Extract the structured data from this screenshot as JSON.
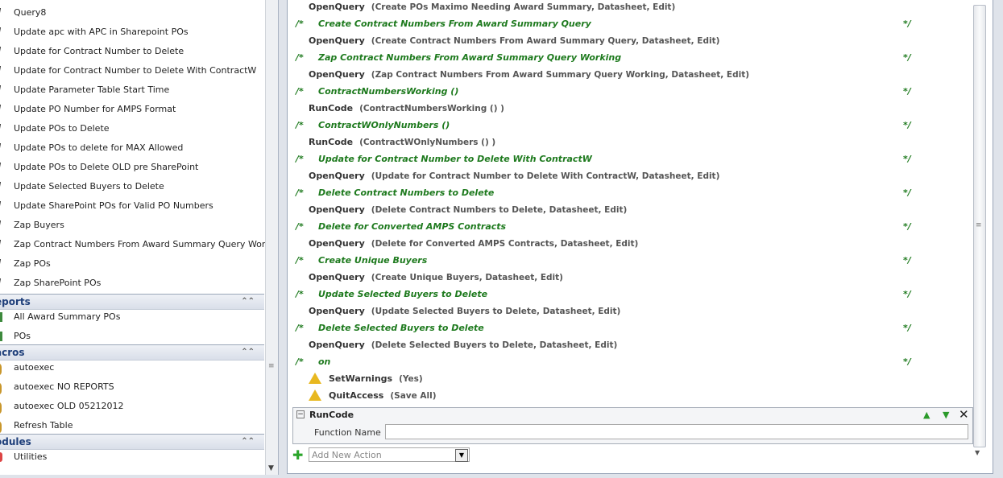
{
  "nav": {
    "queries": [
      "Query8",
      "Update apc with APC in Sharepoint POs",
      "Update for Contract Number to Delete",
      "Update for Contract Number to Delete With ContractW",
      "Update Parameter Table Start Time",
      "Update PO Number for AMPS Format",
      "Update POs to Delete",
      "Update POs to delete for MAX Allowed",
      "Update POs to Delete OLD pre SharePoint",
      "Update Selected Buyers to Delete",
      "Update SharePoint POs for Valid PO Numbers",
      "Zap Buyers",
      "Zap Contract Numbers From Award Summary Query Worki...",
      "Zap POs",
      "Zap SharePoint POs"
    ],
    "groups": [
      {
        "title": "eports",
        "items": [
          "All Award Summary POs",
          "POs"
        ]
      },
      {
        "title": "acros",
        "items": [
          "autoexec",
          "autoexec NO REPORTS",
          "autoexec OLD 05212012",
          "Refresh Table"
        ]
      },
      {
        "title": "odules",
        "items": [
          "Utilities"
        ]
      }
    ],
    "collapse_icon": "⌃⌃"
  },
  "macro": {
    "comment_open": "/*",
    "comment_close": "*/",
    "rows": [
      {
        "type": "action",
        "name": "OpenQuery",
        "args": "(Create POs Maximo Needing Award Summary, Datasheet, Edit)"
      },
      {
        "type": "comment",
        "text": "Create Contract Numbers From Award Summary Query"
      },
      {
        "type": "action",
        "name": "OpenQuery",
        "args": "(Create Contract Numbers From Award Summary Query, Datasheet, Edit)"
      },
      {
        "type": "comment",
        "text": "Zap Contract Numbers From Award Summary Query Working"
      },
      {
        "type": "action",
        "name": "OpenQuery",
        "args": "(Zap Contract Numbers From Award Summary Query Working, Datasheet, Edit)"
      },
      {
        "type": "comment",
        "text": "ContractNumbersWorking ()"
      },
      {
        "type": "action",
        "name": "RunCode",
        "args": "(ContractNumbersWorking () )"
      },
      {
        "type": "comment",
        "text": "ContractWOnlyNumbers ()"
      },
      {
        "type": "action",
        "name": "RunCode",
        "args": "(ContractWOnlyNumbers () )"
      },
      {
        "type": "comment",
        "text": "Update for Contract Number to Delete With ContractW"
      },
      {
        "type": "action",
        "name": "OpenQuery",
        "args": "(Update for Contract Number to Delete With ContractW, Datasheet, Edit)"
      },
      {
        "type": "comment",
        "text": "Delete Contract Numbers to Delete"
      },
      {
        "type": "action",
        "name": "OpenQuery",
        "args": "(Delete Contract Numbers to Delete, Datasheet, Edit)"
      },
      {
        "type": "comment",
        "text": "Delete for Converted AMPS Contracts"
      },
      {
        "type": "action",
        "name": "OpenQuery",
        "args": "(Delete for Converted AMPS Contracts, Datasheet, Edit)"
      },
      {
        "type": "comment",
        "text": "Create Unique Buyers"
      },
      {
        "type": "action",
        "name": "OpenQuery",
        "args": "(Create Unique Buyers, Datasheet, Edit)"
      },
      {
        "type": "comment",
        "text": "Update Selected Buyers to Delete"
      },
      {
        "type": "action",
        "name": "OpenQuery",
        "args": "(Update Selected Buyers to Delete, Datasheet, Edit)"
      },
      {
        "type": "comment",
        "text": "Delete Selected Buyers to Delete"
      },
      {
        "type": "action",
        "name": "OpenQuery",
        "args": "(Delete Selected Buyers to Delete, Datasheet, Edit)"
      },
      {
        "type": "comment",
        "text": "on"
      },
      {
        "type": "warn",
        "name": "SetWarnings",
        "args": "(Yes)"
      },
      {
        "type": "warn",
        "name": "QuitAccess",
        "args": "(Save All)"
      }
    ],
    "edit": {
      "title": "RunCode",
      "field_label": "Function Name",
      "field_value": ""
    },
    "add_action_placeholder": "Add New Action"
  },
  "colors": {
    "comment": "#1e7a1e",
    "group_header": "#1f3f7a"
  }
}
